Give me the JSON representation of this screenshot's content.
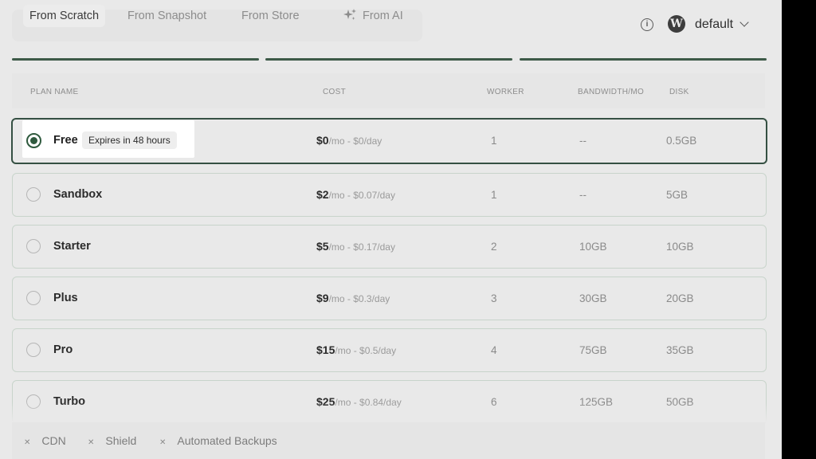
{
  "tabs": [
    {
      "label": "From Scratch",
      "active": true
    },
    {
      "label": "From Snapshot",
      "active": false
    },
    {
      "label": "From Store",
      "active": false
    },
    {
      "label": "From AI",
      "active": false
    }
  ],
  "header": {
    "info_icon": "info-icon",
    "site_icon": "wordpress-icon",
    "site_icon_glyph": "W",
    "site_name": "default",
    "info_glyph": "i"
  },
  "table": {
    "columns": [
      "PLAN NAME",
      "COST",
      "WORKER",
      "BANDWIDTH/MO",
      "DISK"
    ],
    "rows": [
      {
        "name": "Free",
        "badge": "Expires in 48 hours",
        "price": "$0",
        "period": "/mo - $0/day",
        "worker": "1",
        "bandwidth": "--",
        "disk": "0.5GB",
        "selected": true
      },
      {
        "name": "Sandbox",
        "price": "$2",
        "period": "/mo - $0.07/day",
        "worker": "1",
        "bandwidth": "--",
        "disk": "5GB",
        "selected": false
      },
      {
        "name": "Starter",
        "price": "$5",
        "period": "/mo - $0.17/day",
        "worker": "2",
        "bandwidth": "10GB",
        "disk": "10GB",
        "selected": false
      },
      {
        "name": "Plus",
        "price": "$9",
        "period": "/mo - $0.3/day",
        "worker": "3",
        "bandwidth": "30GB",
        "disk": "20GB",
        "selected": false
      },
      {
        "name": "Pro",
        "price": "$15",
        "period": "/mo - $0.5/day",
        "worker": "4",
        "bandwidth": "75GB",
        "disk": "35GB",
        "selected": false
      },
      {
        "name": "Turbo",
        "price": "$25",
        "period": "/mo - $0.84/day",
        "worker": "6",
        "bandwidth": "125GB",
        "disk": "50GB",
        "selected": false
      }
    ]
  },
  "addons": [
    {
      "label": "CDN",
      "glyph": "✕"
    },
    {
      "label": "Shield",
      "glyph": "✕"
    },
    {
      "label": "Automated Backups",
      "glyph": "✕"
    }
  ],
  "colors": {
    "accent": "#355043",
    "background": "#e9e9e9"
  }
}
